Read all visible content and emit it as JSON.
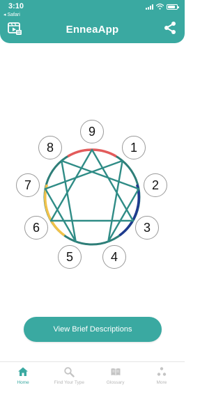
{
  "status_bar": {
    "time": "3:10",
    "back_label": "◂ Safari"
  },
  "header": {
    "title": "EnneaApp"
  },
  "diagram": {
    "numbers": [
      "9",
      "1",
      "2",
      "3",
      "4",
      "5",
      "6",
      "7",
      "8"
    ],
    "colors": {
      "circle": "#2e7e78",
      "lines": "#2f8c86",
      "arc_red": "#e35b5b",
      "arc_blue": "#1f3b8f",
      "arc_yellow": "#f1c24a"
    }
  },
  "cta": {
    "label": "View Brief Descriptions"
  },
  "tabs": [
    {
      "label": "Home",
      "icon": "home-icon",
      "active": true
    },
    {
      "label": "Find Your Type",
      "icon": "search-icon",
      "active": false
    },
    {
      "label": "Glossary",
      "icon": "book-icon",
      "active": false
    },
    {
      "label": "More",
      "icon": "more-dots-icon",
      "active": false
    }
  ],
  "accent_color": "#3aa9a1"
}
